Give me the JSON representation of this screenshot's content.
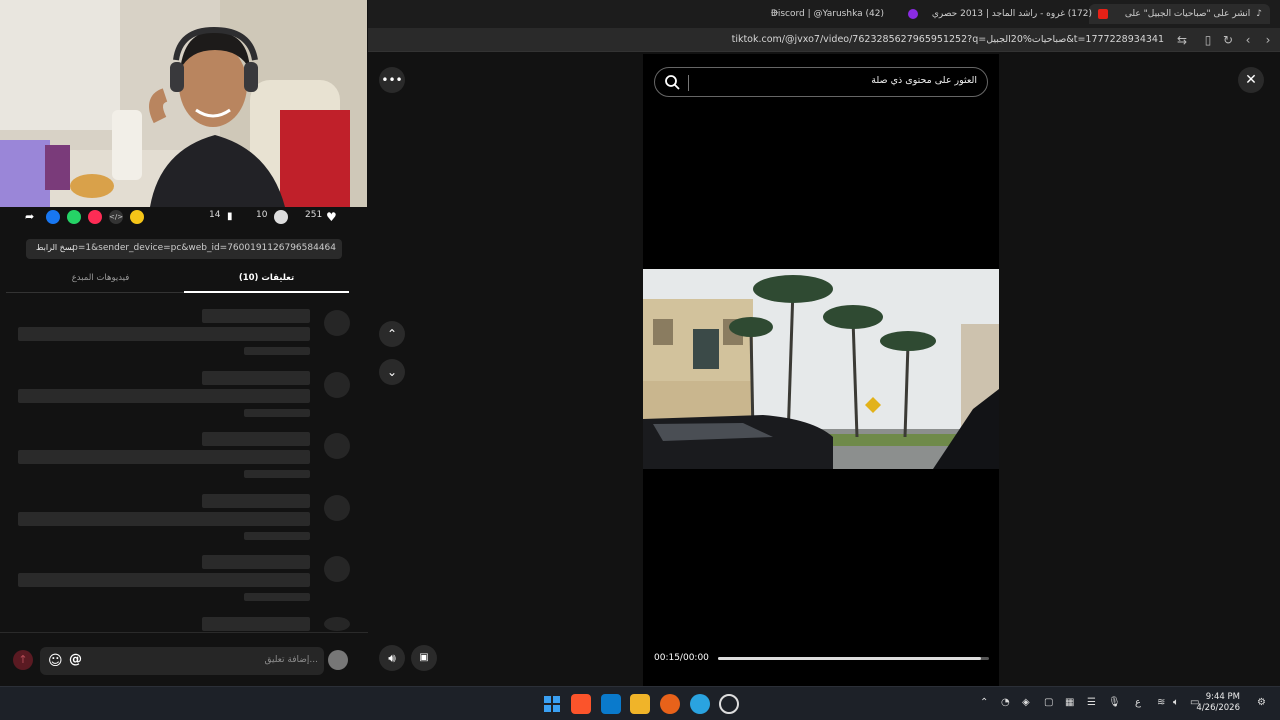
{
  "browser": {
    "tabs": [
      {
        "title": "انشر على \"صباحيات الجبيل\" على",
        "active": true
      },
      {
        "title": "(172) غروه - راشد الماجد | 2013 حصري",
        "active": false
      },
      {
        "title": "(42) Discord | @Yarushka",
        "active": false
      }
    ],
    "url": "tiktok.com/@jvxo7/video/7623285627965951252?q=صباحيات%20الجبيل&t=1777228934341"
  },
  "post": {
    "likes": "251",
    "comments": "10",
    "saves": "14",
    "share_link": "...p=1&sender_device=pc&web_id=7600191126796584464",
    "copy_link_label": "نسخ الرابط",
    "tabs": [
      {
        "label": "تعليقات (10)",
        "active": true
      },
      {
        "label": "فيديوهات المبدع",
        "active": false
      }
    ],
    "comment_placeholder": "إضافة تعليق..."
  },
  "video": {
    "search_text": "العثور على محتوى ذي صلة",
    "time": "00:15/00:00",
    "progress": 0.97
  },
  "taskbar": {
    "lang": "ع",
    "time": "9:44 PM",
    "date": "4/26/2026"
  },
  "colors": {
    "accent": "#fe2c55",
    "background": "#121212"
  }
}
